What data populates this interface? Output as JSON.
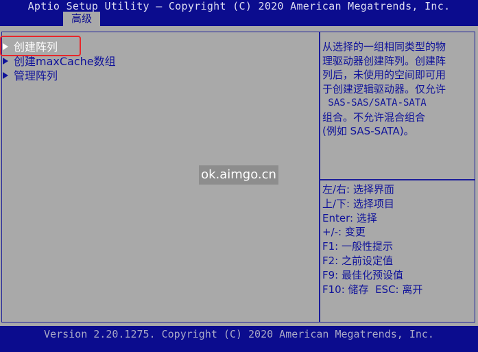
{
  "header": {
    "title": "Aptio Setup Utility – Copyright (C) 2020 American Megatrends, Inc.",
    "tab": "高级"
  },
  "menu": {
    "items": [
      {
        "label": "创建阵列",
        "selected": true
      },
      {
        "label": "创建maxCache数组",
        "selected": false
      },
      {
        "label": "管理阵列",
        "selected": false
      }
    ]
  },
  "help": {
    "lines": [
      "从选择的一组相同类型的物",
      "理驱动器创建阵列。创建阵",
      "列后，未使用的空间即可用",
      "于创建逻辑驱动器。仅允许",
      " SAS-SAS/SATA-SATA",
      "组合。不允许混合组合",
      "(例如 SAS-SATA)。"
    ]
  },
  "keys": {
    "lines": [
      "左/右: 选择界面",
      "上/下: 选择项目",
      "Enter: 选择",
      "+/-: 变更",
      "F1: 一般性提示",
      "F2: 之前设定值",
      "F9: 最佳化预设值",
      "F10: 储存  ESC: 离开"
    ]
  },
  "watermark": "ok.aimgo.cn",
  "footer": {
    "text": "Version 2.20.1275. Copyright (C) 2020 American Megatrends, Inc."
  },
  "colors": {
    "bios_blue": "#0b0c8e",
    "panel_gray": "#a9a9a9",
    "highlight_red": "#e8262a",
    "selected_text": "#ffffff"
  }
}
